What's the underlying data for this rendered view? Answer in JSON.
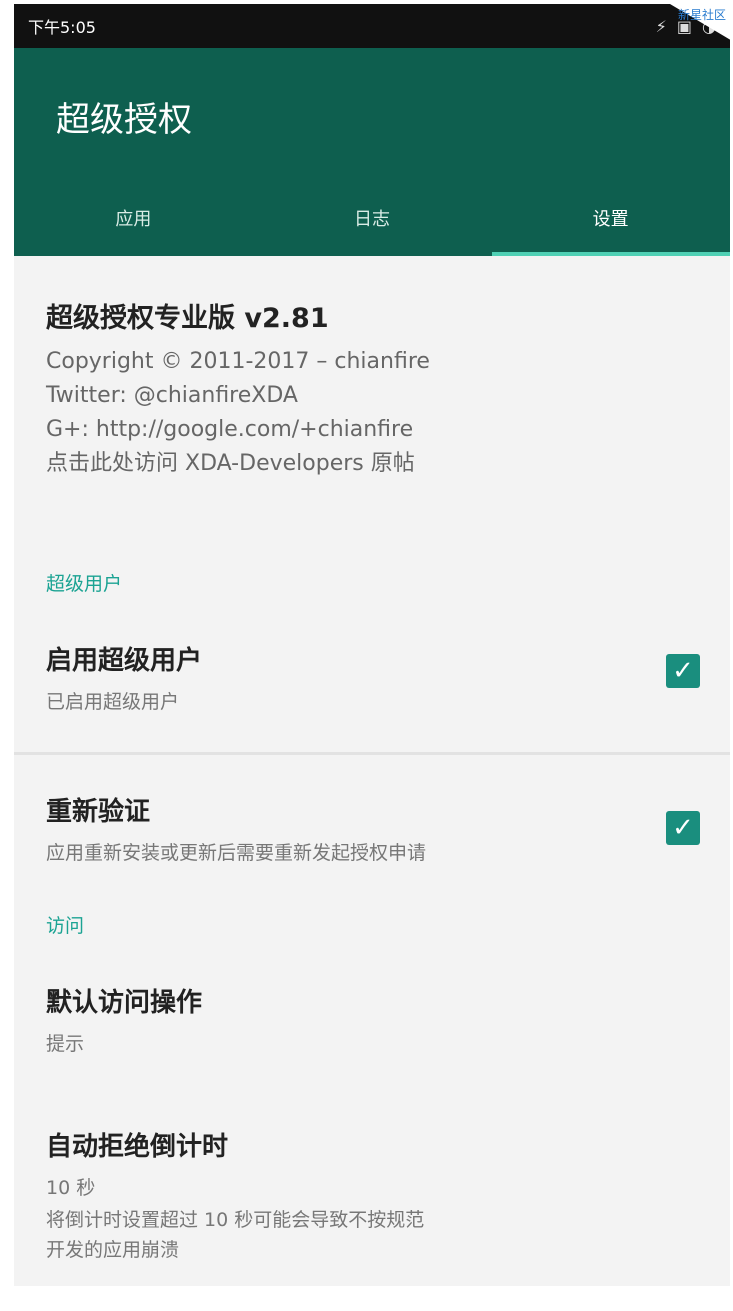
{
  "status_bar": {
    "time": "下午5:05",
    "icons": [
      "flash-icon",
      "nfc-icon",
      "battery-icon"
    ]
  },
  "corner_tag": {
    "text": "新星社区"
  },
  "appbar": {
    "title": "超级授权",
    "tabs": [
      {
        "label": "应用",
        "active": false
      },
      {
        "label": "日志",
        "active": false
      },
      {
        "label": "设置",
        "active": true
      }
    ],
    "accent_color": "#4fd0b4",
    "background_color": "#0e5f4f"
  },
  "about": {
    "title": "超级授权专业版 v2.81",
    "lines": [
      "Copyright © 2011-2017 – chianfire",
      "Twitter: @chianfireXDA",
      "G+: http://google.com/+chianfire",
      "点击此处访问 XDA-Developers 原帖"
    ]
  },
  "sections": {
    "superuser": {
      "header": "超级用户",
      "enable": {
        "title": "启用超级用户",
        "summary": "已启用超级用户",
        "checked": true
      },
      "reauth": {
        "title": "重新验证",
        "summary": "应用重新安装或更新后需要重新发起授权申请",
        "checked": true
      }
    },
    "access": {
      "header": "访问",
      "default_action": {
        "title": "默认访问操作",
        "summary": "提示"
      },
      "auto_deny": {
        "title": "自动拒绝倒计时",
        "summary_value": "10 秒",
        "summary_note_line1": "将倒计时设置超过 10 秒可能会导致不按规范",
        "summary_note_line2": "开发的应用崩溃"
      }
    }
  },
  "checkmark": "✓",
  "check_color": "#1a8e7e",
  "section_color": "#1ba393"
}
